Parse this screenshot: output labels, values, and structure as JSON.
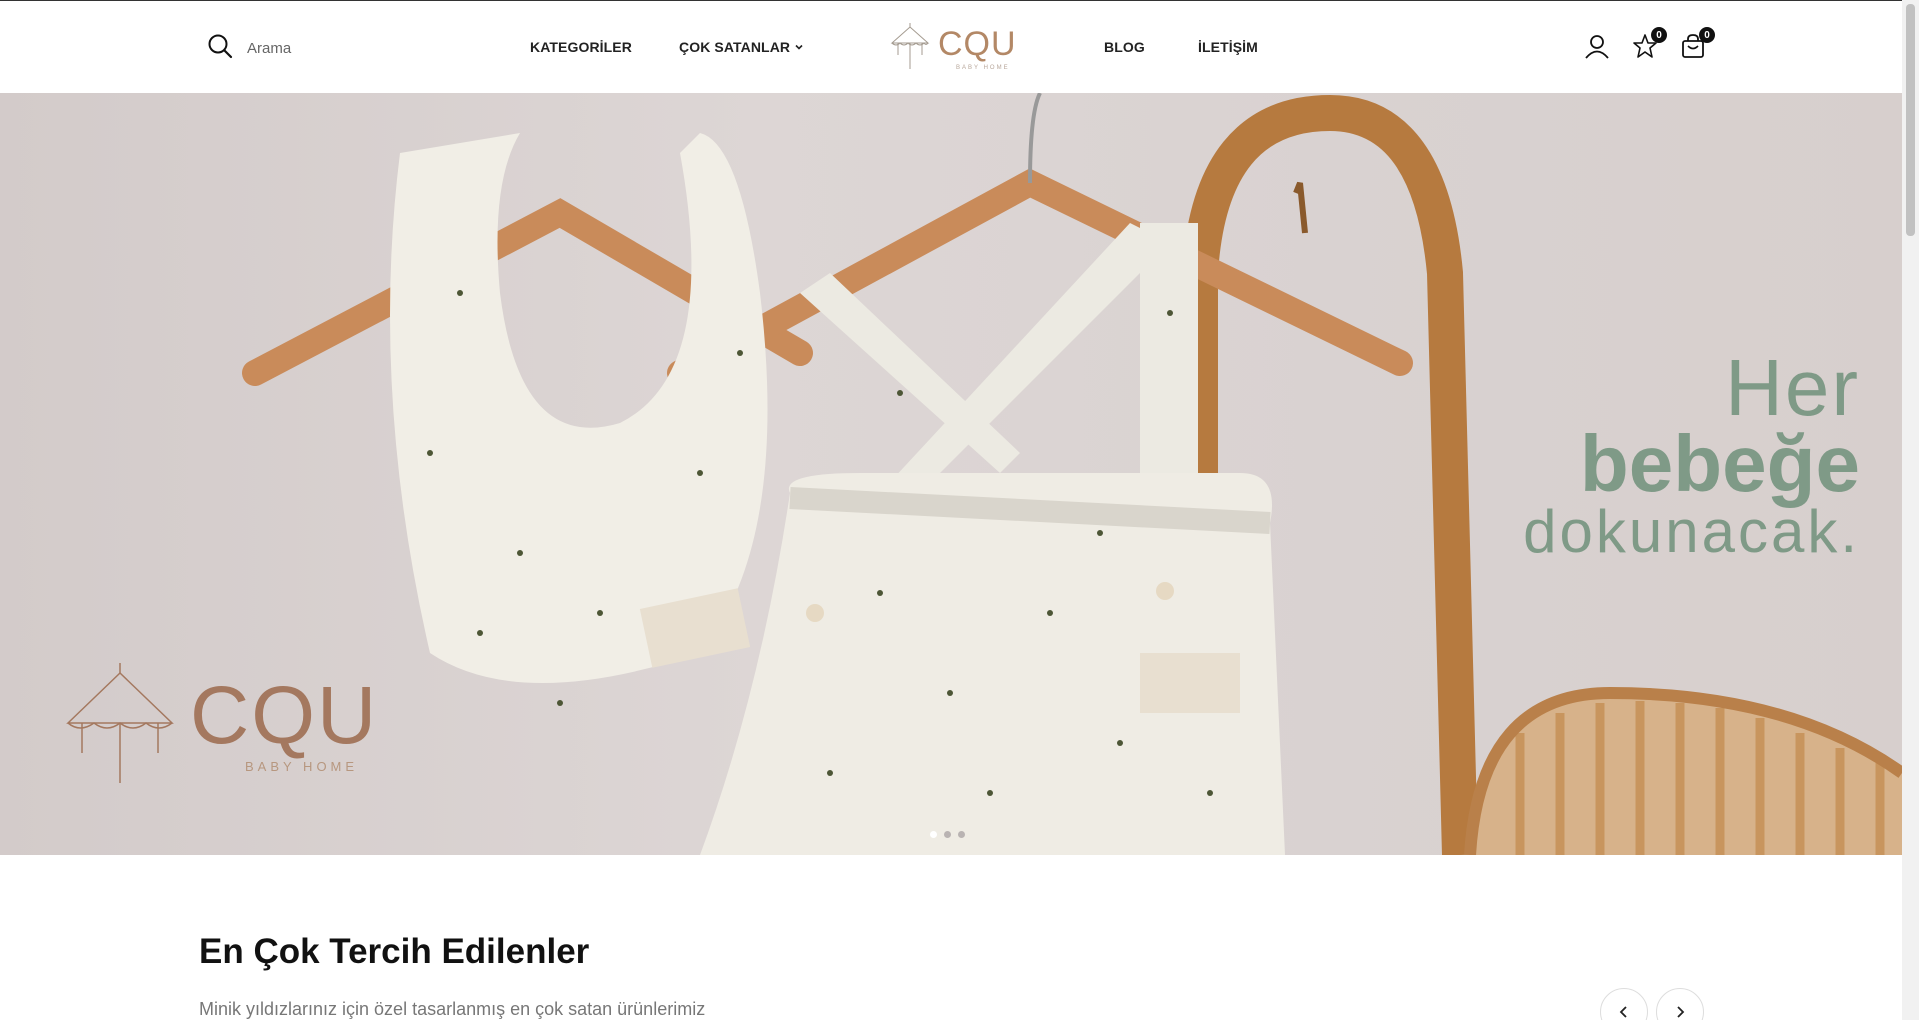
{
  "header": {
    "search": {
      "placeholder": "Arama"
    },
    "nav": {
      "categories": "KATEGORİLER",
      "bestsellers": "ÇOK SATANLAR",
      "blog": "BLOG",
      "contact": "İLETİŞİM"
    },
    "logo": {
      "text": "CQU",
      "sub": "BABY HOME"
    },
    "wishlist_count": "0",
    "cart_count": "0"
  },
  "hero": {
    "line1": "Her",
    "line2": "bebeğe",
    "line3": "dokunacak.",
    "brand": "CQU",
    "brand_sub": "BABY HOME",
    "slide_count": 3,
    "active_slide": 1
  },
  "section": {
    "title": "En Çok Tercih Edilenler",
    "subtitle": "Minik yıldızlarınız için özel tasarlanmış en çok satan ürünlerimiz"
  },
  "colors": {
    "accent": "#7f9a87",
    "brand_brown": "#a4785f",
    "hero_bg": "#d9d2d1"
  }
}
